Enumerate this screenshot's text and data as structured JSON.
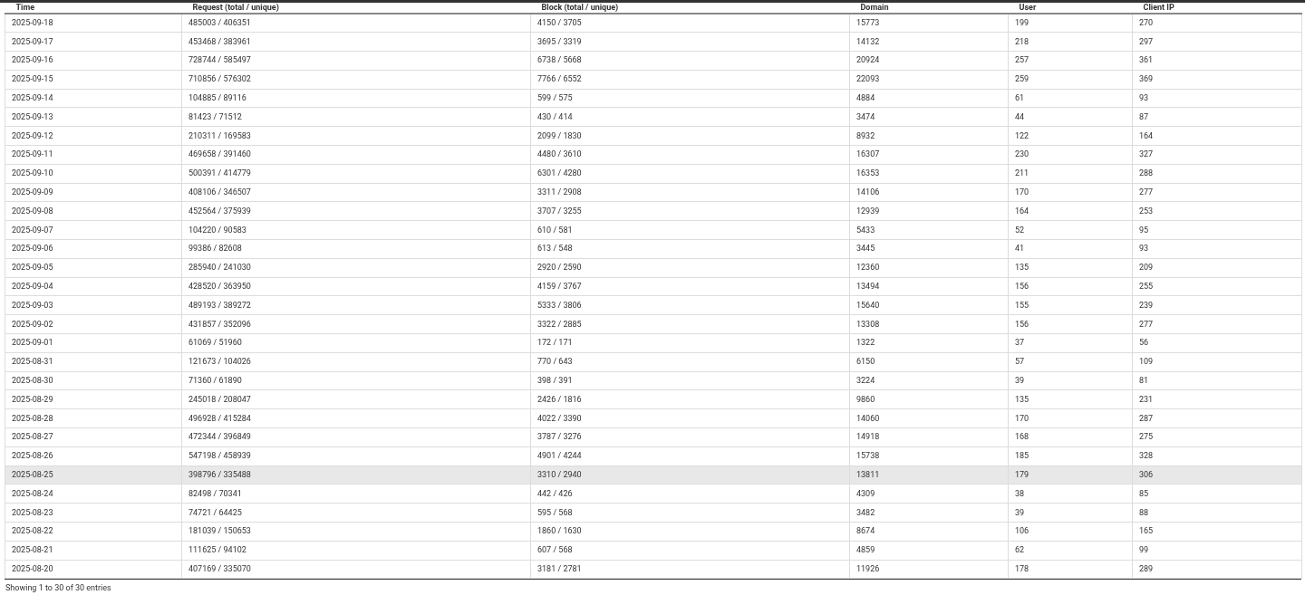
{
  "table": {
    "columns": [
      "Time",
      "Request (total / unique)",
      "Block (total / unique)",
      "Domain",
      "User",
      "Client IP"
    ],
    "rows": [
      {
        "cells": [
          "2025-09-18",
          "485003 / 406351",
          "4150 / 3705",
          "15773",
          "199",
          "270"
        ],
        "selected": false
      },
      {
        "cells": [
          "2025-09-17",
          "453468 / 383961",
          "3695 / 3319",
          "14132",
          "218",
          "297"
        ],
        "selected": false
      },
      {
        "cells": [
          "2025-09-16",
          "728744 / 585497",
          "6738 / 5668",
          "20924",
          "257",
          "361"
        ],
        "selected": false
      },
      {
        "cells": [
          "2025-09-15",
          "710856 / 576302",
          "7766 / 6552",
          "22093",
          "259",
          "369"
        ],
        "selected": false
      },
      {
        "cells": [
          "2025-09-14",
          "104885 / 89116",
          "599 / 575",
          "4884",
          "61",
          "93"
        ],
        "selected": false
      },
      {
        "cells": [
          "2025-09-13",
          "81423 / 71512",
          "430 / 414",
          "3474",
          "44",
          "87"
        ],
        "selected": false
      },
      {
        "cells": [
          "2025-09-12",
          "210311 / 169583",
          "2099 / 1830",
          "8932",
          "122",
          "164"
        ],
        "selected": false
      },
      {
        "cells": [
          "2025-09-11",
          "469658 / 391460",
          "4480 / 3610",
          "16307",
          "230",
          "327"
        ],
        "selected": false
      },
      {
        "cells": [
          "2025-09-10",
          "500391 / 414779",
          "6301 / 4280",
          "16353",
          "211",
          "288"
        ],
        "selected": false
      },
      {
        "cells": [
          "2025-09-09",
          "408106 / 346507",
          "3311 / 2908",
          "14106",
          "170",
          "277"
        ],
        "selected": false
      },
      {
        "cells": [
          "2025-09-08",
          "452564 / 375939",
          "3707 / 3255",
          "12939",
          "164",
          "253"
        ],
        "selected": false
      },
      {
        "cells": [
          "2025-09-07",
          "104220 / 90583",
          "610 / 581",
          "5433",
          "52",
          "95"
        ],
        "selected": false
      },
      {
        "cells": [
          "2025-09-06",
          "99386 / 82608",
          "613 / 548",
          "3445",
          "41",
          "93"
        ],
        "selected": false
      },
      {
        "cells": [
          "2025-09-05",
          "285940 / 241030",
          "2920 / 2590",
          "12360",
          "135",
          "209"
        ],
        "selected": false
      },
      {
        "cells": [
          "2025-09-04",
          "428520 / 363950",
          "4159 / 3767",
          "13494",
          "156",
          "255"
        ],
        "selected": false
      },
      {
        "cells": [
          "2025-09-03",
          "489193 / 389272",
          "5333 / 3806",
          "15640",
          "155",
          "239"
        ],
        "selected": false
      },
      {
        "cells": [
          "2025-09-02",
          "431857 / 352096",
          "3322 / 2885",
          "13308",
          "156",
          "277"
        ],
        "selected": false
      },
      {
        "cells": [
          "2025-09-01",
          "61069 / 51960",
          "172 / 171",
          "1322",
          "37",
          "56"
        ],
        "selected": false
      },
      {
        "cells": [
          "2025-08-31",
          "121673 / 104026",
          "770 / 643",
          "6150",
          "57",
          "109"
        ],
        "selected": false
      },
      {
        "cells": [
          "2025-08-30",
          "71360 / 61890",
          "398 / 391",
          "3224",
          "39",
          "81"
        ],
        "selected": false
      },
      {
        "cells": [
          "2025-08-29",
          "245018 / 208047",
          "2426 / 1816",
          "9860",
          "135",
          "231"
        ],
        "selected": false
      },
      {
        "cells": [
          "2025-08-28",
          "496928 / 415284",
          "4022 / 3390",
          "14060",
          "170",
          "287"
        ],
        "selected": false
      },
      {
        "cells": [
          "2025-08-27",
          "472344 / 396849",
          "3787 / 3276",
          "14918",
          "168",
          "275"
        ],
        "selected": false
      },
      {
        "cells": [
          "2025-08-26",
          "547198 / 458939",
          "4901 / 4244",
          "15738",
          "185",
          "328"
        ],
        "selected": false
      },
      {
        "cells": [
          "2025-08-25",
          "398796 / 335488",
          "3310 / 2940",
          "13811",
          "179",
          "306"
        ],
        "selected": true
      },
      {
        "cells": [
          "2025-08-24",
          "82498 / 70341",
          "442 / 426",
          "4309",
          "38",
          "85"
        ],
        "selected": false
      },
      {
        "cells": [
          "2025-08-23",
          "74721 / 64425",
          "595 / 568",
          "3482",
          "39",
          "88"
        ],
        "selected": false
      },
      {
        "cells": [
          "2025-08-22",
          "181039 / 150653",
          "1860 / 1630",
          "8674",
          "106",
          "165"
        ],
        "selected": false
      },
      {
        "cells": [
          "2025-08-21",
          "111625 / 94102",
          "607 / 568",
          "4859",
          "62",
          "99"
        ],
        "selected": false
      },
      {
        "cells": [
          "2025-08-20",
          "407169 / 335070",
          "3181 / 2781",
          "11926",
          "178",
          "289"
        ],
        "selected": false
      }
    ]
  },
  "info": "Showing 1 to 30 of 30 entries"
}
